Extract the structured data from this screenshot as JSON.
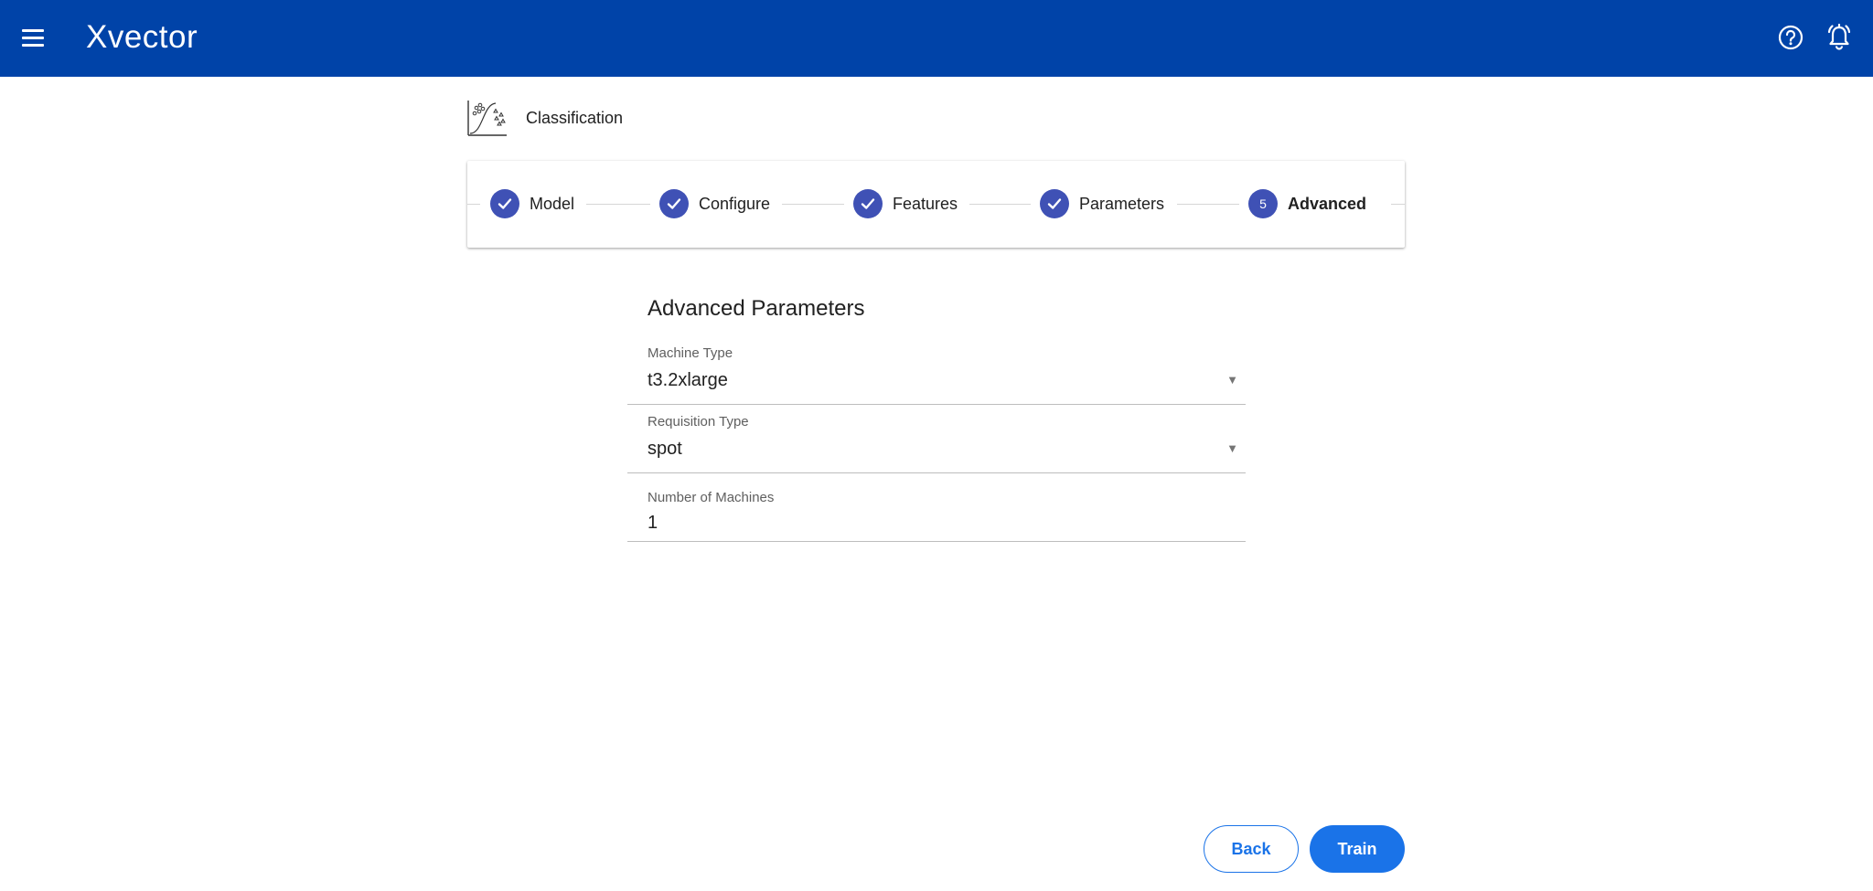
{
  "app": {
    "title": "Xvector",
    "menu_icon": "hamburger-menu-icon",
    "help_icon": "help-circle-icon",
    "notifications_icon": "bell-icon",
    "brand_color": "#0043a8"
  },
  "page": {
    "icon": "classification-chart-icon",
    "title": "Classification"
  },
  "stepper": {
    "steps": [
      {
        "label": "Model",
        "state": "completed",
        "icon": "check-icon"
      },
      {
        "label": "Configure",
        "state": "completed",
        "icon": "check-icon"
      },
      {
        "label": "Features",
        "state": "completed",
        "icon": "check-icon"
      },
      {
        "label": "Parameters",
        "state": "completed",
        "icon": "check-icon"
      },
      {
        "label": "Advanced",
        "state": "active",
        "number": "5"
      }
    ],
    "step_color": "#3f51b5"
  },
  "form": {
    "title": "Advanced Parameters",
    "machine_type": {
      "label": "Machine Type",
      "value": "t3.2xlarge"
    },
    "requisition_type": {
      "label": "Requisition Type",
      "value": "spot"
    },
    "number_of_machines": {
      "label": "Number of Machines",
      "value": "1"
    }
  },
  "actions": {
    "back_label": "Back",
    "train_label": "Train",
    "accent_color": "#1a73e8"
  }
}
